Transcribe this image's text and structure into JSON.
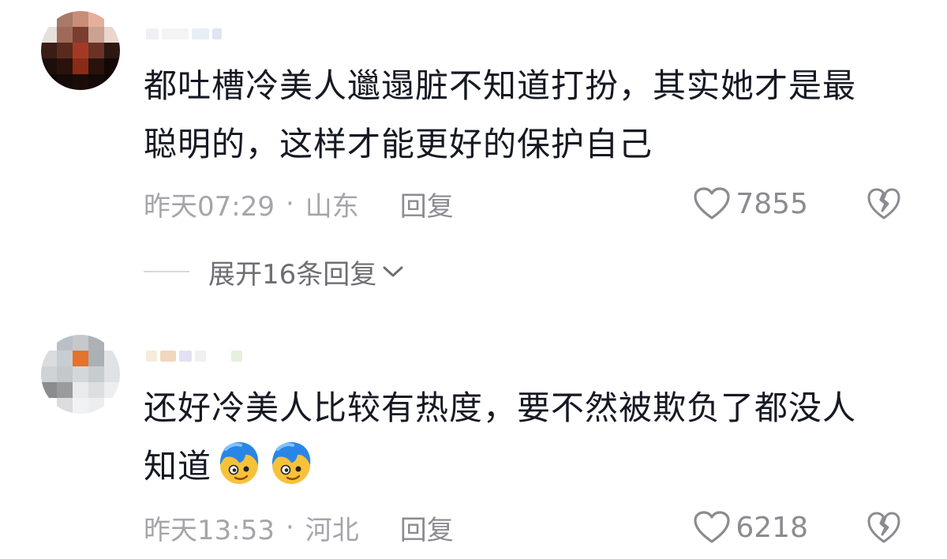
{
  "comments": [
    {
      "content_line1": "都吐槽冷美人邋遢脏不知道打扮，其实她才是最",
      "content_line2": "聪明的，这样才能更好的保护自己",
      "time": "昨天07:29",
      "separator": "·",
      "location": "山东",
      "reply_label": "回复",
      "likes": "7855",
      "expand_label": "展开16条回复"
    },
    {
      "content_line1": "还好冷美人比较有热度，要不然被欺负了都没人",
      "content_line2": "知道",
      "time": "昨天13:53",
      "separator": "·",
      "location": "河北",
      "reply_label": "回复",
      "likes": "6218"
    }
  ],
  "colors": {
    "text": "#161823",
    "meta": "#a5a5aa",
    "icon": "#8b8b90"
  },
  "icons": {
    "like": "heart-icon",
    "dislike": "broken-heart-icon",
    "expand": "chevron-down-icon",
    "emoji": "blue-hair-face-emoji"
  }
}
